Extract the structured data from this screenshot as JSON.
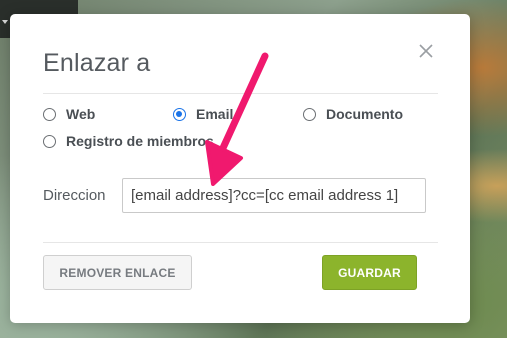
{
  "dialog": {
    "title": "Enlazar a",
    "close_icon": "close-icon"
  },
  "link_types": [
    {
      "label": "Web",
      "checked": false
    },
    {
      "label": "Email",
      "checked": true
    },
    {
      "label": "Documento",
      "checked": false
    },
    {
      "label": "Registro de miembros",
      "checked": false
    }
  ],
  "address": {
    "label": "Direccion",
    "value": "[email address]?cc=[cc email address 1]"
  },
  "buttons": {
    "remove_label": "REMOVER ENLACE",
    "save_label": "GUARDAR"
  },
  "colors": {
    "accent_radio": "#1a73e8",
    "save_button": "#8cb42c",
    "annotation_arrow": "#f0196e"
  }
}
